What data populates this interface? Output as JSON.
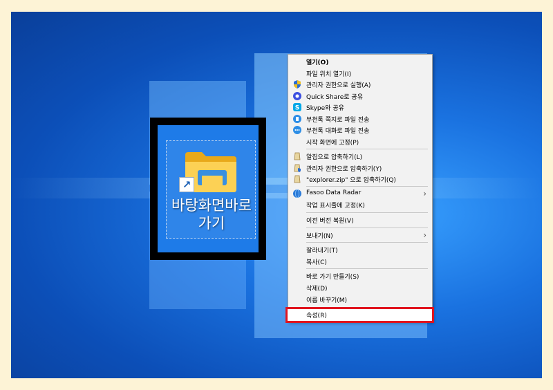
{
  "desktop_icon": {
    "label_line1": "바탕화면바로",
    "label_line2": "가기"
  },
  "menu": {
    "open": "열기(O)",
    "open_location": "파일 위치 열기(I)",
    "run_admin": "관리자 권한으로 실행(A)",
    "quick_share": "Quick Share로 공유",
    "skype": "Skype와 공유",
    "buzzer_note": "부천톡 쪽지로 파일 전송",
    "buzzer_chat": "부천톡 대화로 파일 전송",
    "pin_start": "시작 화면에 고정(P)",
    "alzip_compress": "알집으로 압축하기(L)",
    "admin_compress": "관리자 권한으로 압축하기(Y)",
    "zip_compress": "\"explorer.zip\" 으로 압축하기(Q)",
    "fasoo": "Fasoo Data Radar",
    "pin_taskbar": "작업 표시줄에 고정(K)",
    "restore": "이전 버전 복원(V)",
    "send_to": "보내기(N)",
    "cut": "잘라내기(T)",
    "copy": "복사(C)",
    "create_shortcut": "바로 가기 만들기(S)",
    "delete": "삭제(D)",
    "rename": "이름 바꾸기(M)",
    "properties": "속성(R)"
  },
  "colors": {
    "highlight_border": "#e0141e",
    "desktop_blue": "#1a72e0"
  }
}
